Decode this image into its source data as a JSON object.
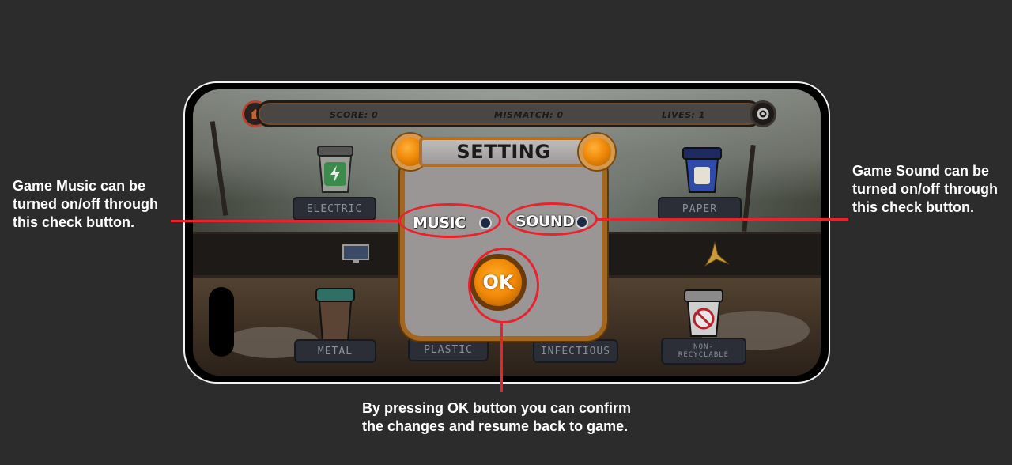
{
  "hud": {
    "score": "SCORE: 0",
    "mismatch": "MISMATCH: 0",
    "lives": "LIVES: 1",
    "home_icon": "home-icon",
    "settings_icon": "gear-icon"
  },
  "bins": {
    "top": [
      "ELECTRIC",
      "PAPER"
    ],
    "bottom": [
      "METAL",
      "PLASTIC",
      "INFECTIOUS",
      "NON-\nRECYCLABLE"
    ]
  },
  "dialog": {
    "title": "SETTING",
    "music_label": "MUSIC",
    "sound_label": "SOUND",
    "ok_label": "OK"
  },
  "annotations": {
    "music": "Game Music can be turned on/off through this check button.",
    "sound": "Game Sound can be turned on/off through this check button.",
    "ok": "By pressing OK button you can confirm the changes and resume back to game."
  },
  "colors": {
    "highlight": "#e8232e",
    "accent_orange": "#f08a08",
    "panel_grey": "#9a9696"
  }
}
